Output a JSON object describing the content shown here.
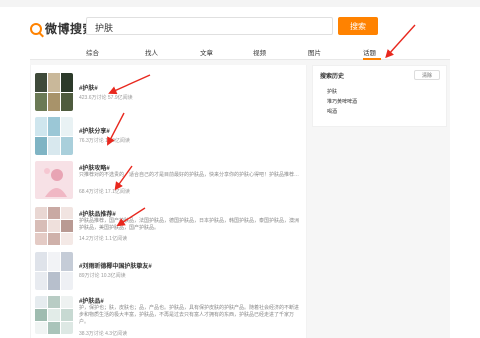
{
  "top_bar": {
    "links": [
      "",
      ""
    ]
  },
  "header": {
    "logo_text": "微博搜索",
    "search_value": "护肤",
    "search_button": "搜索"
  },
  "tabs": [
    {
      "label": "综合"
    },
    {
      "label": "找人"
    },
    {
      "label": "文章"
    },
    {
      "label": "视频"
    },
    {
      "label": "图片"
    },
    {
      "label": "话题",
      "active": true
    }
  ],
  "results": [
    {
      "title": "#护肤#",
      "desc": "",
      "stats": "423.6万讨论 57.9亿阅读"
    },
    {
      "title": "#护肤分享#",
      "desc": "",
      "stats": "76.3万讨论 12.9亿阅读"
    },
    {
      "title": "#护肤攻略#",
      "desc": "只推荐对的不选贵的，适合自己的才是目前最好的护肤品，快来分享你的护肤心得吧！护肤品推荐…",
      "stats": "68.4万讨论 17.1亿阅读"
    },
    {
      "title": "#护肤品推荐#",
      "desc": "护肤品推荐，国产护肤品，法国护肤品，德国护肤品，日本护肤品，韩国护肤品，泰国护肤品，澳洲护肤品，美国护肤品，国产护肤品。",
      "stats": "14.2万讨论 1.1亿阅读"
    },
    {
      "title": "#刘雨昕德椰中国护肤挚友#",
      "desc": "",
      "stats": "89万讨论 10.3亿阅读"
    },
    {
      "title": "#护肤品#",
      "desc": "护，保护也；肤，皮肤也；品，产品也。护肤品，具有保护皮肤的护肤产品。随着社会经济的不断进步和物质生活的极大丰富，护肤品，不再是过去只有富人才拥有的东西，护肤品已经走进了千家万户。",
      "stats": "38.3万讨论 4.3亿阅读"
    }
  ],
  "sidebar": {
    "title": "搜索历史",
    "clear_label": "清除",
    "history": [
      "护肤",
      "堆巧黄啤啤酒",
      "喝酒"
    ]
  },
  "colors": {
    "accent": "#ff8200",
    "annotation": "#e8281e"
  }
}
